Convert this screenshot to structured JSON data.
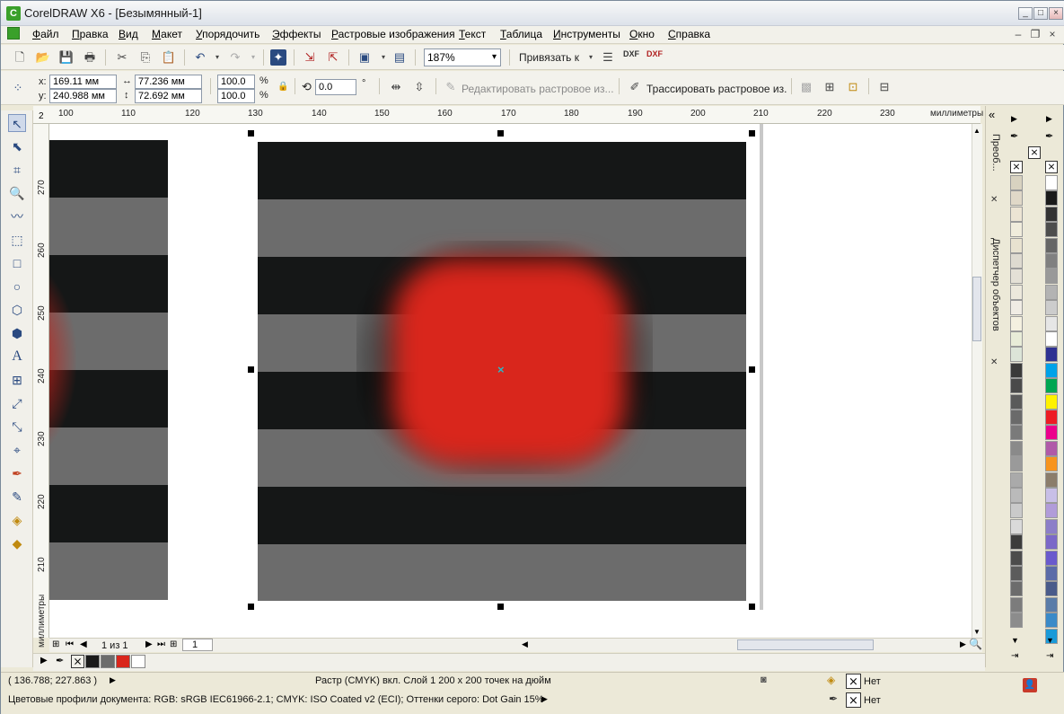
{
  "window": {
    "title": "CorelDRAW X6 - [Безымянный-1]",
    "minimize": "_",
    "maximize": "□",
    "close": "×"
  },
  "menu": {
    "items": [
      "Файл",
      "Правка",
      "Вид",
      "Макет",
      "Упорядочить",
      "Эффекты",
      "Растровые изображения",
      "Текст",
      "Таблица",
      "Инструменты",
      "Окно",
      "Справка"
    ]
  },
  "toolbar": {
    "zoom_value": "187%",
    "snap_label": "Привязать к",
    "dxf1": "DXF",
    "dxf2": "DXF"
  },
  "propbar": {
    "x_label": "x:",
    "y_label": "y:",
    "x_value": "169.11 мм",
    "y_value": "240.988 мм",
    "w_value": "77.236 мм",
    "h_value": "72.692 мм",
    "scale_w": "100.0",
    "scale_h": "100.0",
    "percent": "%",
    "rotation_value": "0.0",
    "degree": "°",
    "edit_bitmap_label": "Редактировать растровое из...",
    "trace_bitmap_label": "Трассировать растровое из."
  },
  "ruler": {
    "h_ticks": [
      "100",
      "110",
      "120",
      "130",
      "140",
      "150",
      "160",
      "170",
      "180",
      "190",
      "200",
      "210",
      "220",
      "230"
    ],
    "h_unit": "миллиметры",
    "v_ticks": [
      "270",
      "260",
      "250",
      "240",
      "230",
      "220",
      "210"
    ],
    "v_unit": "миллиметры",
    "v_top": "2"
  },
  "pagenav": {
    "page_count": "1 из 1",
    "page_tab": "1"
  },
  "docker": {
    "tab1": "Преоб...",
    "tab2": "Диспетчер объектов",
    "collapse": "«",
    "close1": "✕",
    "close2": "✕"
  },
  "status": {
    "coords": "( 136.788; 227.863 )",
    "object_info": "Растр (CMYK) вкл. Слой 1 200 x 200 точек на дюйм",
    "color_profiles": "Цветовые профили документа: RGB: sRGB IEC61966-2.1; CMYK: ISO Coated v2 (ECI); Оттенки серого: Dot Gain 15%",
    "fill_none": "Нет",
    "outline_none": "Нет"
  },
  "colors": {
    "stripe_dark": "#151717",
    "stripe_gray": "#6c6c6c",
    "red_blob": "#d9261c",
    "canvas_bg": "#ffffff",
    "ui_bg": "#ece9d8"
  },
  "icons": {
    "new": "new-document-icon",
    "open": "open-icon",
    "save": "save-icon",
    "print": "print-icon",
    "cut": "cut-icon",
    "copy": "copy-icon",
    "paste": "paste-icon",
    "undo": "undo-icon",
    "redo": "redo-icon",
    "search": "search-icon",
    "import": "import-icon",
    "export": "export-icon"
  },
  "palette_right": [
    "#ffffff",
    "#1a1a1a",
    "#333333",
    "#4d4d4d",
    "#666666",
    "#808080",
    "#999999",
    "#b3b3b3",
    "#cccccc",
    "#e6e6e6",
    "#ffffff",
    "#2e3192",
    "#00a2e8",
    "#00a651",
    "#fff200",
    "#ed1c24",
    "#ec008c",
    "#b05aa8",
    "#f7941d",
    "#8b7d6b",
    "#c8bfe7",
    "#b19cd9",
    "#8c7ec8",
    "#7b68c8",
    "#6a5acd",
    "#5b6ba8",
    "#4a5b8a",
    "#5a7ca8",
    "#3a8ac8",
    "#1a9ad8"
  ],
  "palette_left": [
    "#d8d2c0",
    "#e0d8c8",
    "#ece4d4",
    "#f0ecdc",
    "#e8e2d0",
    "#dedad0",
    "#e4e0d6",
    "#ece8dc",
    "#f0ece4",
    "#f4f0e0",
    "#e8ecd8",
    "#dce4d8",
    "#3a3a3a",
    "#4a4a4a",
    "#5a5a5a",
    "#6a6a6a",
    "#7a7a7a",
    "#8a8a8a",
    "#9a9a9a",
    "#aaaaaa",
    "#bababa",
    "#cacaca",
    "#dadada",
    "#3c3c3c",
    "#4c4c4c",
    "#5c5c5c",
    "#6c6c6c",
    "#7c7c7c",
    "#8c8c8c",
    "#9c9c9c"
  ],
  "doc_palette": [
    "#1a1a1a",
    "#6c6c6c",
    "#d9261c",
    "#ffffff"
  ]
}
